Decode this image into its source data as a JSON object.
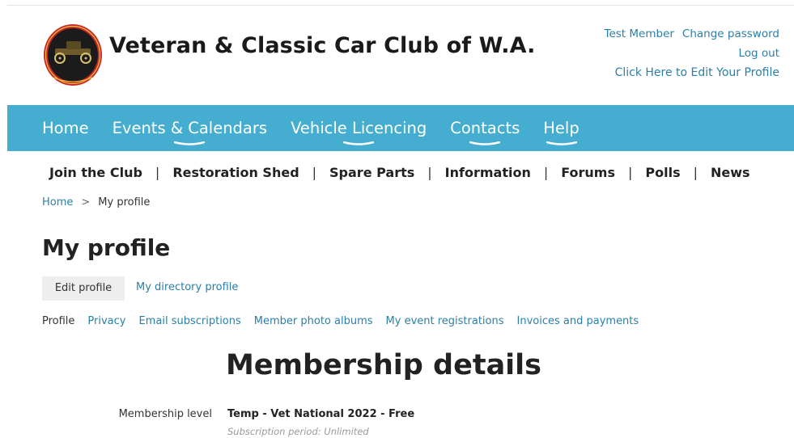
{
  "header": {
    "site_title": "Veteran & Classic Car Club of W.A.",
    "logo_icon": "vintage-car-club-emblem-icon",
    "logo_colors": {
      "ring": "#c62828",
      "center": "#1b1b1b",
      "car": "#f0c040"
    },
    "account": {
      "member_name": "Test Member",
      "change_password": "Change password",
      "logout": "Log out",
      "edit_profile": "Click Here to Edit Your Profile"
    }
  },
  "main_nav": {
    "color": "#45aed0",
    "items": [
      {
        "label": "Home",
        "has_submenu": false
      },
      {
        "label": "Events & Calendars",
        "has_submenu": true
      },
      {
        "label": "Vehicle Licencing",
        "has_submenu": true
      },
      {
        "label": "Contacts",
        "has_submenu": true
      },
      {
        "label": "Help",
        "has_submenu": true
      }
    ]
  },
  "sub_nav": {
    "separator": "|",
    "items": [
      "Join the Club",
      "Restoration Shed",
      "Spare Parts",
      "Information",
      "Forums",
      "Polls",
      "News"
    ]
  },
  "breadcrumb": {
    "home": "Home",
    "separator": ">",
    "current": "My profile"
  },
  "page": {
    "title": "My profile",
    "edit_profile_button": "Edit profile",
    "directory_profile_link": "My directory profile",
    "tabs": {
      "active": "Profile",
      "links": [
        "Privacy",
        "Email subscriptions",
        "Member photo albums",
        "My event registrations",
        "Invoices and payments"
      ]
    },
    "section_title": "Membership details",
    "membership": {
      "label": "Membership level",
      "value": "Temp - Vet National 2022 - Free",
      "subscription": "Subscription period: Unlimited"
    }
  }
}
